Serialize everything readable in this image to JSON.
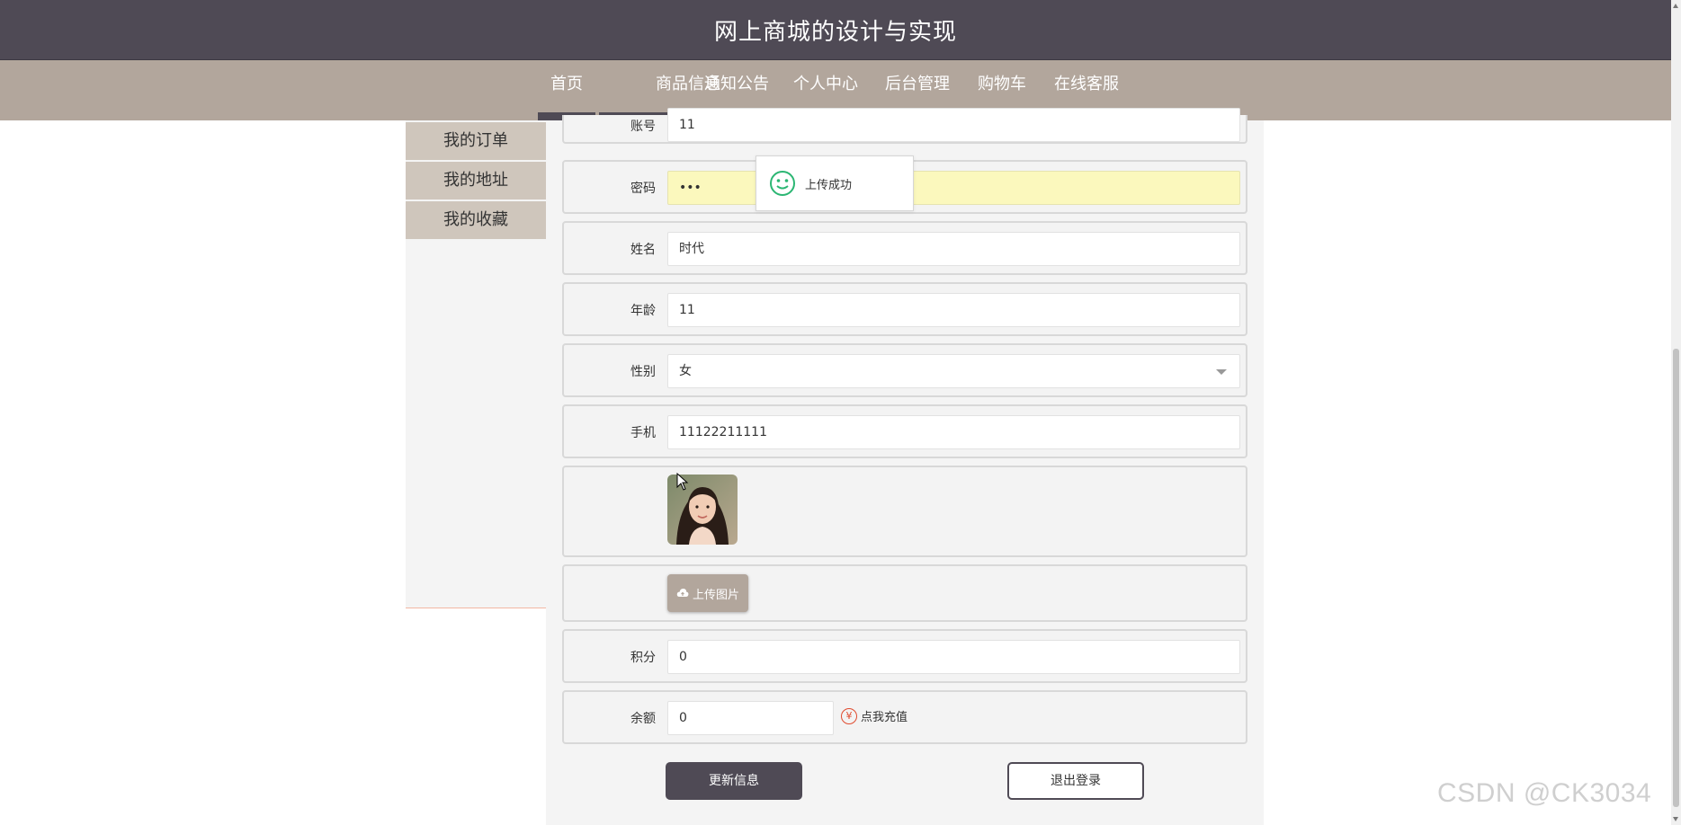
{
  "header": {
    "site_title": "网上商城的设计与实现"
  },
  "nav": {
    "items": [
      {
        "label": "首页",
        "active": false
      },
      {
        "label": "商品信息",
        "active": false
      },
      {
        "label": "通知公告",
        "active": false
      },
      {
        "label": "个人中心",
        "active": true
      },
      {
        "label": "后台管理",
        "active": false
      },
      {
        "label": "购物车",
        "active": false
      },
      {
        "label": "在线客服",
        "active": false
      }
    ]
  },
  "sidebar": {
    "items": [
      {
        "label": "我的订单"
      },
      {
        "label": "我的地址"
      },
      {
        "label": "我的收藏"
      }
    ]
  },
  "form": {
    "account": {
      "label": "账号",
      "value": "11"
    },
    "password": {
      "label": "密码",
      "value": "•••"
    },
    "name": {
      "label": "姓名",
      "value": "时代"
    },
    "age": {
      "label": "年龄",
      "value": "11"
    },
    "gender": {
      "label": "性别",
      "value": "女"
    },
    "phone": {
      "label": "手机",
      "value": "11122211111"
    },
    "upload_label": "上传图片",
    "points": {
      "label": "积分",
      "value": "0"
    },
    "balance": {
      "label": "余额",
      "value": "0"
    },
    "recharge_label": "点我充值",
    "recharge_symbol": "¥"
  },
  "actions": {
    "update_label": "更新信息",
    "logout_label": "退出登录"
  },
  "toast": {
    "message": "上传成功"
  },
  "watermark": "CSDN @CK3034",
  "colors": {
    "header_bg": "#4f4a55",
    "nav_bg": "#b2a69c",
    "sidebar_item_bg": "#cfc6bc",
    "accent_red": "#e04b2f",
    "toast_icon": "#2bb673"
  }
}
